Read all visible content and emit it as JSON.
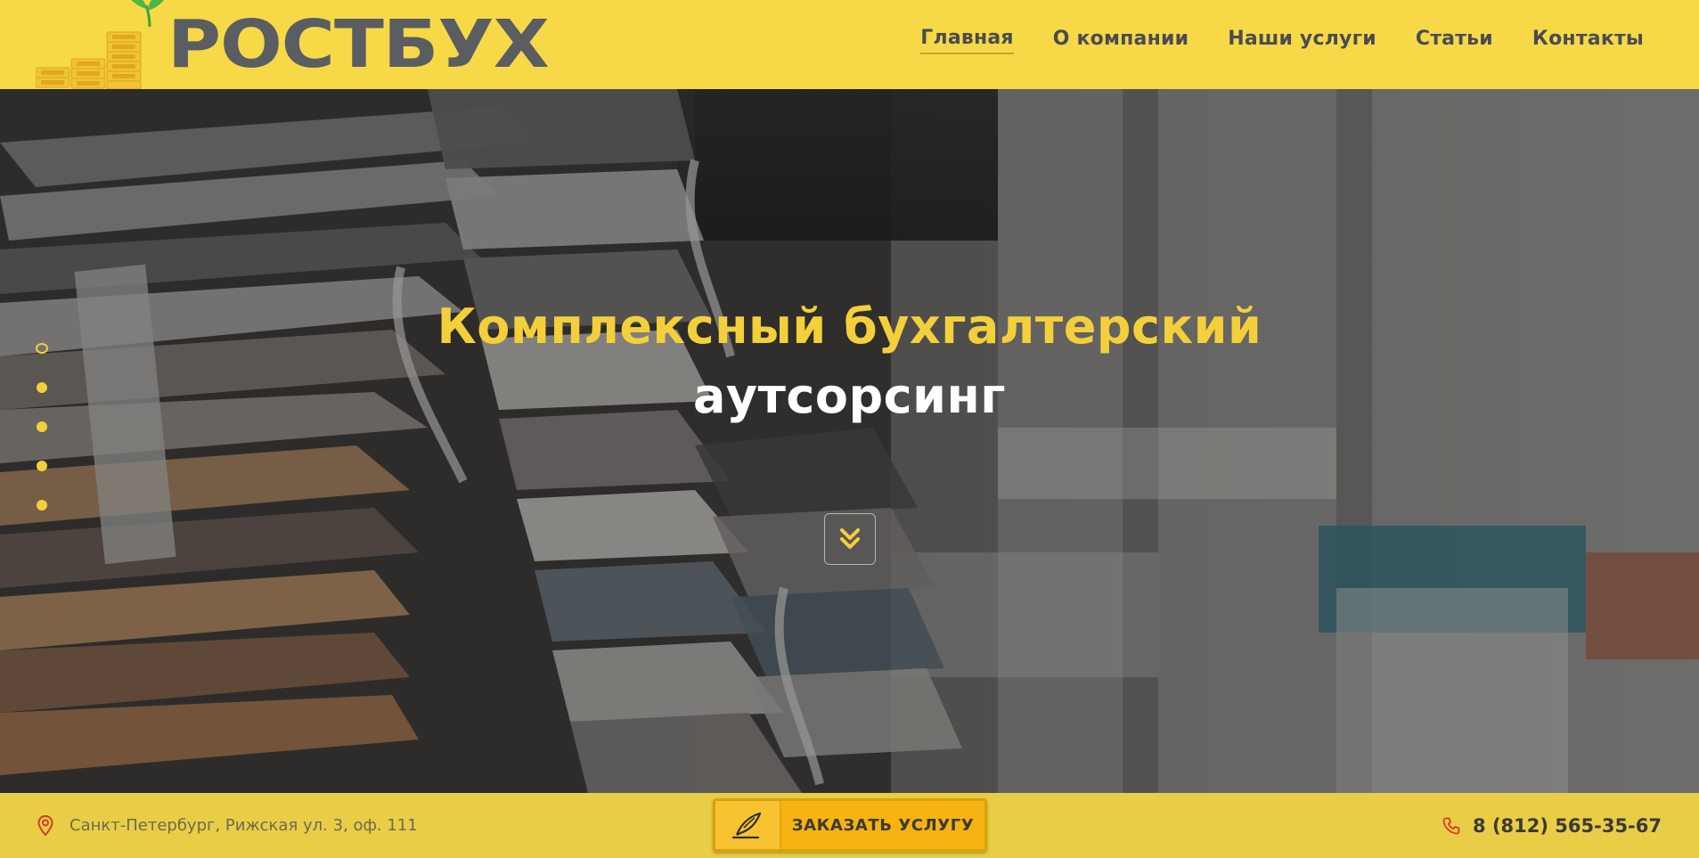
{
  "logo": {
    "brand": "РОСТБУХ"
  },
  "nav": {
    "items": [
      {
        "label": "Главная",
        "active": true
      },
      {
        "label": "О компании"
      },
      {
        "label": "Наши услуги"
      },
      {
        "label": "Статьи"
      },
      {
        "label": "Контакты"
      }
    ]
  },
  "hero": {
    "title_line1": "Комплексный бухгалтерский",
    "title_line2": "аутсорсинг",
    "slides_count": 5,
    "active_slide": 1
  },
  "footer_bar": {
    "address": "Санкт-Петербург, Рижская ул. 3, оф. 111",
    "order_label": "ЗАКАЗАТЬ УСЛУГУ",
    "phone": "8 (812) 565-35-67"
  },
  "colors": {
    "header_bg": "#f7d948",
    "accent_yellow": "#f4cf3c",
    "button_orange": "#f6b311",
    "nav_text": "#4a4c50",
    "logo_text": "#5a5d62",
    "icon_red": "#d43b2a"
  },
  "icons": {
    "scroll": "chevron-double-down-icon",
    "address": "map-pin-icon",
    "order": "quill-pen-icon",
    "phone": "phone-icon"
  }
}
